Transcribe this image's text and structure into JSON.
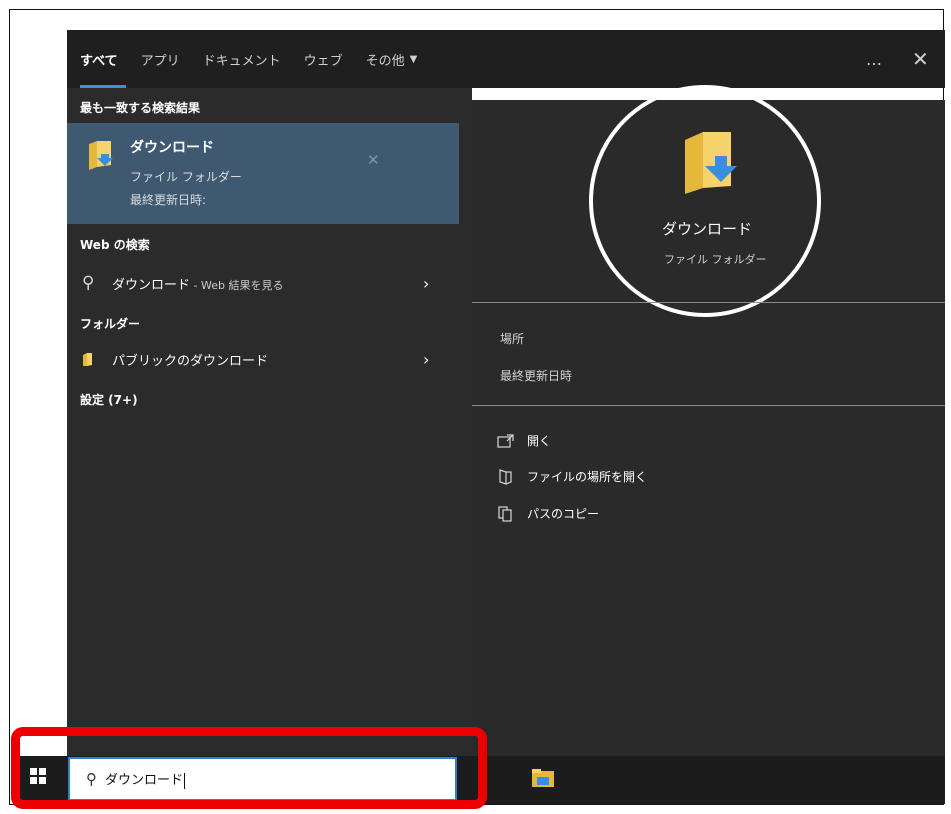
{
  "tabs": [
    {
      "label": "すべて",
      "active": true
    },
    {
      "label": "アプリ"
    },
    {
      "label": "ドキュメント"
    },
    {
      "label": "ウェブ"
    },
    {
      "label": "その他",
      "caret": "▼"
    }
  ],
  "window": {
    "more": "…",
    "close": "✕"
  },
  "best_match": {
    "header": "最も一致する検索結果",
    "title": "ダウンロード",
    "subtitle": "ファイル フォルダー",
    "modified": "最終更新日時:",
    "dismiss": "✕"
  },
  "web": {
    "header": "Web の検索",
    "query": "ダウンロード",
    "suffix": " - Web 結果を見る",
    "chevron": "›"
  },
  "folders": {
    "header": "フォルダー",
    "item": "パブリックのダウンロード",
    "chevron": "›"
  },
  "settings": {
    "label": "設定 (7+)"
  },
  "preview": {
    "title": "ダウンロード",
    "subtitle": "ファイル フォルダー",
    "location_label": "場所",
    "modified_label": "最終更新日時",
    "actions": [
      {
        "label": "開く",
        "icon": "open-icon"
      },
      {
        "label": "ファイルの場所を開く",
        "icon": "file-location-icon"
      },
      {
        "label": "パスのコピー",
        "icon": "copy-path-icon"
      }
    ]
  },
  "taskbar": {
    "search_value": "ダウンロード"
  },
  "colors": {
    "accent": "#3a8fe0",
    "highlight": "#3f5970",
    "annotation": "#ef0000"
  }
}
